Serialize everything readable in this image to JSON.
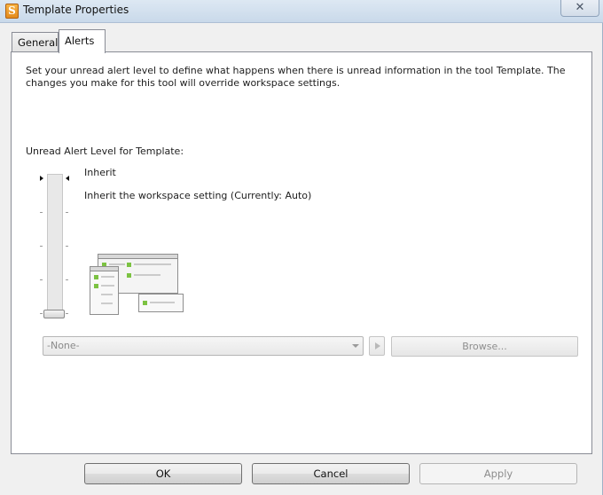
{
  "window": {
    "title": "Template Properties",
    "app_icon_letter": "S",
    "close_symbol": "✕"
  },
  "tabs": [
    {
      "label": "General",
      "selected": false
    },
    {
      "label": "Alerts",
      "selected": true
    }
  ],
  "alerts": {
    "intro": "Set your unread alert level to define what happens when there is unread information in the tool Template.  The changes you make for this tool will override workspace settings.",
    "level_label": "Unread Alert Level for Template:",
    "current_level": "Inherit",
    "current_level_description": "Inherit the workspace setting (Currently: Auto)",
    "sound_select_value": "-None-",
    "browse_label": "Browse..."
  },
  "buttons": {
    "ok": "OK",
    "cancel": "Cancel",
    "apply": "Apply"
  },
  "colors": {
    "accent_green": "#7cc242",
    "disabled_text": "#8d8d8d"
  }
}
